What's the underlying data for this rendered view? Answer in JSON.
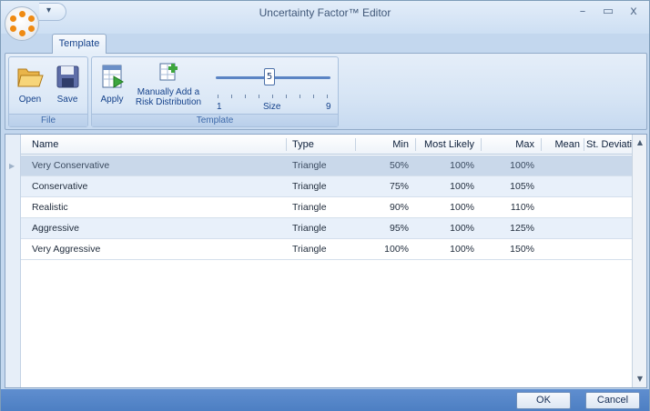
{
  "window": {
    "title": "Uncertainty Factor™ Editor",
    "minimize_glyph": "–",
    "maximize_glyph": "▭",
    "close_glyph": "x"
  },
  "ribbon": {
    "active_tab": "Template",
    "groups": {
      "file": {
        "label": "File",
        "open_label": "Open",
        "save_label": "Save"
      },
      "template": {
        "label": "Template",
        "apply_label": "Apply",
        "add_dist_label_line1": "Manually Add a",
        "add_dist_label_line2": "Risk Distribution",
        "size_slider": {
          "value": "5",
          "min_label": "1",
          "max_label": "9",
          "caption": "Size"
        }
      }
    }
  },
  "grid": {
    "columns": [
      "Name",
      "Type",
      "Min",
      "Most Likely",
      "Max",
      "Mean",
      "St. Deviation"
    ],
    "rows": [
      {
        "name": "Very Conservative",
        "type": "Triangle",
        "min": "50%",
        "most_likely": "100%",
        "max": "100%",
        "mean": "",
        "st_dev": ""
      },
      {
        "name": "Conservative",
        "type": "Triangle",
        "min": "75%",
        "most_likely": "100%",
        "max": "105%",
        "mean": "",
        "st_dev": ""
      },
      {
        "name": "Realistic",
        "type": "Triangle",
        "min": "90%",
        "most_likely": "100%",
        "max": "110%",
        "mean": "",
        "st_dev": ""
      },
      {
        "name": "Aggressive",
        "type": "Triangle",
        "min": "95%",
        "most_likely": "100%",
        "max": "125%",
        "mean": "",
        "st_dev": ""
      },
      {
        "name": "Very Aggressive",
        "type": "Triangle",
        "min": "100%",
        "most_likely": "100%",
        "max": "150%",
        "mean": "",
        "st_dev": ""
      }
    ]
  },
  "buttons": {
    "ok_label": "OK",
    "cancel_label": "Cancel"
  },
  "colors": {
    "accent": "#15428b",
    "selected_row": "#c9d8ea",
    "alt_row": "#e8f0fa",
    "bottom_bar": "#5583c6",
    "orb_dots": "#ef8a12"
  }
}
